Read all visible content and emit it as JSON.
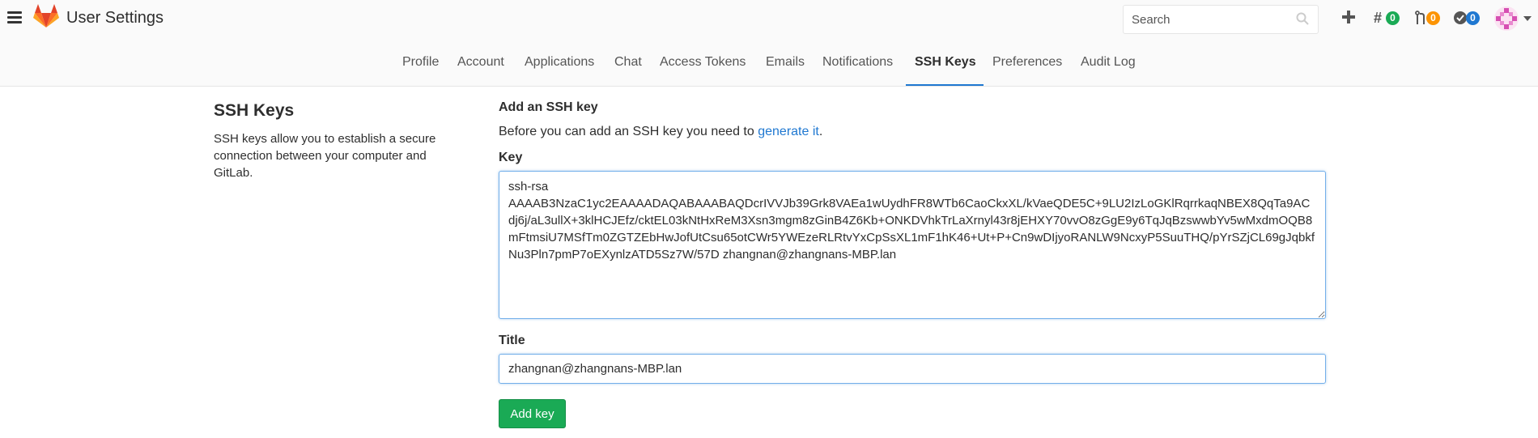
{
  "header": {
    "app_title": "User Settings",
    "search_placeholder": "Search",
    "icons": [
      "menu-icon",
      "gitlab-logo",
      "search-icon",
      "plus-icon",
      "issues-icon",
      "merge-requests-icon",
      "todos-icon",
      "avatar-icon"
    ],
    "issues_count": "0",
    "merge_requests_count": "0",
    "todos_count": "0"
  },
  "tabs": [
    {
      "label": "Profile"
    },
    {
      "label": "Account"
    },
    {
      "label": "Applications"
    },
    {
      "label": "Chat"
    },
    {
      "label": "Access Tokens"
    },
    {
      "label": "Emails"
    },
    {
      "label": "Notifications"
    },
    {
      "label": "SSH Keys",
      "active": true
    },
    {
      "label": "Preferences"
    },
    {
      "label": "Audit Log"
    }
  ],
  "sidebar": {
    "title": "SSH Keys",
    "description": "SSH keys allow you to establish a secure connection between your computer and GitLab."
  },
  "form": {
    "heading": "Add an SSH key",
    "intro_text": "Before you can add an SSH key you need to ",
    "intro_link": "generate it",
    "intro_suffix": ".",
    "key_label": "Key",
    "key_value": "ssh-rsa\nAAAAB3NzaC1yc2EAAAADAQABAAABAQDcrIVVJb39Grk8VAEa1wUydhFR8WTb6CaoCkxXL/kVaeQDE5C+9LU2IzLoGKlRqrrkaqNBEX8QqTa9ACdj6j/aL3ullX+3klHCJEfz/cktEL03kNtHxReM3Xsn3mgm8zGinB4Z6Kb+ONKDVhkTrLaXrnyl43r8jEHXY70vvO8zGgE9y6TqJqBzswwbYv5wMxdmOQB8mFtmsiU7MSfTm0ZGTZEbHwJofUtCsu65otCWr5YWEzeRLRtvYxCpSsXL1mF1hK46+Ut+P+Cn9wDIjyoRANLW9NcxyP5SuuTHQ/pYrSZjCL69gJqbkfNu3Pln7pmP7oEXynlzATD5Sz7W/57D zhangnan@zhangnans-MBP.lan",
    "title_label": "Title",
    "title_value": "zhangnan@zhangnans-MBP.lan",
    "add_button_label": "Add key"
  },
  "colors": {
    "accent": "#1f78d1",
    "success": "#1aaa55",
    "warning": "#fc9403",
    "logo": "#e24329"
  }
}
